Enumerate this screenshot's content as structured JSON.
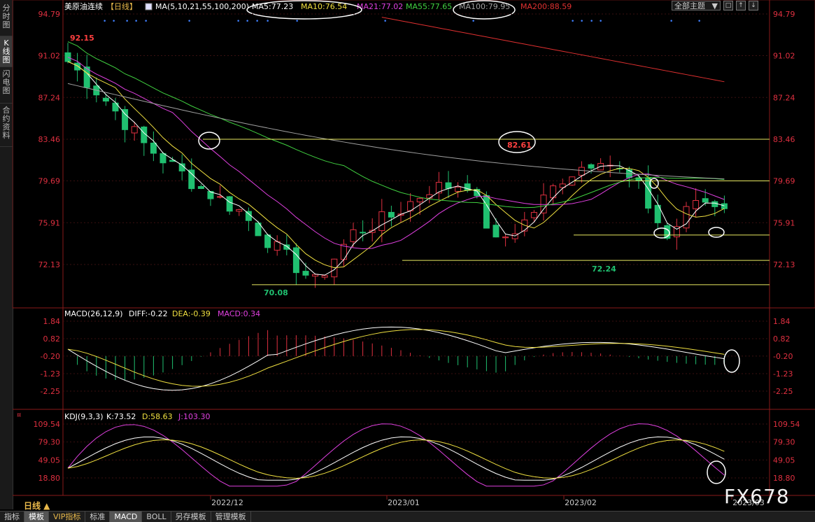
{
  "sidebar": {
    "tabs": [
      {
        "label": "分时图",
        "active": false
      },
      {
        "label": "K线图",
        "active": true
      },
      {
        "label": "闪电图",
        "active": false
      },
      {
        "label": "合约资料",
        "active": false
      }
    ]
  },
  "header": {
    "title": "美原油连续",
    "period": "【日线】",
    "ma_label": "MA(5,10,21,55,100,200)",
    "ma": [
      {
        "text": "MA5:77.23",
        "color": "#ffffff"
      },
      {
        "text": "MA10:76.54",
        "color": "#f0e040"
      },
      {
        "text": "MA21:77.02",
        "color": "#e040e0"
      },
      {
        "text": "MA55:77.65",
        "color": "#40d040"
      },
      {
        "text": "MA100:79.95",
        "color": "#a0a0a0"
      },
      {
        "text": "MA200:88.59",
        "color": "#e03030"
      }
    ],
    "theme_select": "全部主题",
    "arrow": "▼"
  },
  "main_axis": {
    "ticks": [
      "94.79",
      "91.02",
      "87.24",
      "83.46",
      "79.69",
      "75.91",
      "72.13"
    ]
  },
  "price_labels": {
    "high": "92.15",
    "peak": "82.61",
    "low1": "70.08",
    "low2": "72.24"
  },
  "macd": {
    "title": "MACD(26,12,9)",
    "diff": "DIFF:-0.22",
    "dea": "DEA:-0.39",
    "macd": "MACD:0.34",
    "ticks": [
      "1.84",
      "0.82",
      "-0.20",
      "-1.23",
      "-2.25"
    ]
  },
  "kdj": {
    "title": "KDJ(9,3,3)",
    "k": "K:73.52",
    "d": "D:58.63",
    "j": "J:103.30",
    "ticks": [
      "109.54",
      "79.30",
      "49.05",
      "18.80"
    ]
  },
  "dates": [
    "2022/12",
    "2023/01",
    "2023/02",
    "2023/03"
  ],
  "period_label": "日线 ▲",
  "bottom_tabs": [
    {
      "label": "指标",
      "active": false
    },
    {
      "label": "模板",
      "active": true
    },
    {
      "label": "VIP指标",
      "active": false
    },
    {
      "label": "标准",
      "active": false
    },
    {
      "label": "MACD",
      "active": true
    },
    {
      "label": "BOLL",
      "active": false
    },
    {
      "label": "另存模板",
      "active": false
    },
    {
      "label": "管理模板",
      "active": false
    }
  ],
  "watermark": "FX678",
  "colors": {
    "up": "#e03040",
    "down": "#20c070",
    "axis": "#e03040",
    "hline": "#e8e860",
    "grid": "#3a1010"
  }
}
